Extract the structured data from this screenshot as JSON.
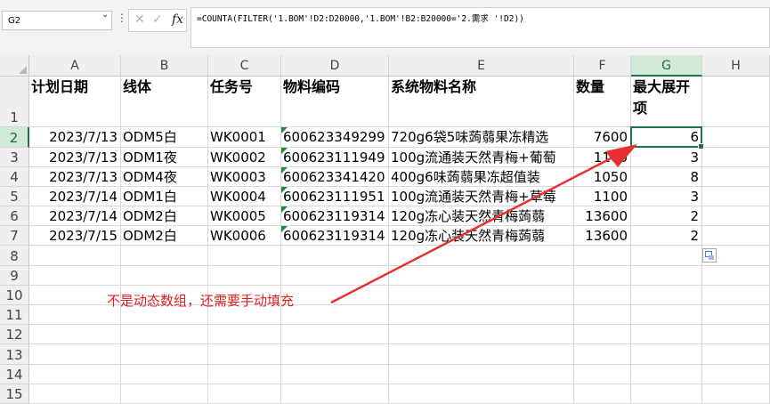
{
  "name_box": {
    "value": "G2"
  },
  "formula_bar": {
    "fx_label": "fx",
    "cancel_glyph": "✕",
    "enter_glyph": "✓",
    "formula": "=COUNTA(FILTER('1.BOM'!D2:D20000,'1.BOM'!B2:B20000='2.需求 '!D2))"
  },
  "columns": [
    "A",
    "B",
    "C",
    "D",
    "E",
    "F",
    "G",
    "H"
  ],
  "rows": [
    "1",
    "2",
    "3",
    "4",
    "5",
    "6",
    "7",
    "8",
    "9",
    "10",
    "11",
    "12",
    "13",
    "14",
    "15"
  ],
  "headers": {
    "plan_date": "计划日期",
    "line": "线体",
    "task_no": "任务号",
    "material_code": "物料编码",
    "material_name": "系统物料名称",
    "quantity": "数量",
    "max_expand": "最大展开项"
  },
  "data_rows": [
    {
      "plan_date": "2023/7/13",
      "line": "ODM5白",
      "task_no": "WK0001",
      "material_code": "600623349299",
      "material_name": "720g6袋5味蒟蒻果冻精选",
      "quantity": "7600",
      "max_expand": "6"
    },
    {
      "plan_date": "2023/7/13",
      "line": "ODM1夜",
      "task_no": "WK0002",
      "material_code": "600623111949",
      "material_name": "100g流通装天然青梅+葡萄",
      "quantity": "1100",
      "max_expand": "3"
    },
    {
      "plan_date": "2023/7/13",
      "line": "ODM4夜",
      "task_no": "WK0003",
      "material_code": "600623341420",
      "material_name": "400g6味蒟蒻果冻超值装",
      "quantity": "1050",
      "max_expand": "8"
    },
    {
      "plan_date": "2023/7/14",
      "line": "ODM1白",
      "task_no": "WK0004",
      "material_code": "600623111951",
      "material_name": "100g流通装天然青梅+草莓",
      "quantity": "1100",
      "max_expand": "3"
    },
    {
      "plan_date": "2023/7/14",
      "line": "ODM2白",
      "task_no": "WK0005",
      "material_code": "600623119314",
      "material_name": "120g冻心装天然青梅蒟蒻",
      "quantity": "13600",
      "max_expand": "2"
    },
    {
      "plan_date": "2023/7/15",
      "line": "ODM2白",
      "task_no": "WK0006",
      "material_code": "600623119314",
      "material_name": "120g冻心装天然青梅蒟蒻",
      "quantity": "13600",
      "max_expand": "2"
    }
  ],
  "annotation": {
    "text": "不是动态数组，还需要手动填充",
    "color": "#e02020"
  },
  "colors": {
    "selection": "#217346",
    "text_error_indicator": "#1f8a3c"
  }
}
